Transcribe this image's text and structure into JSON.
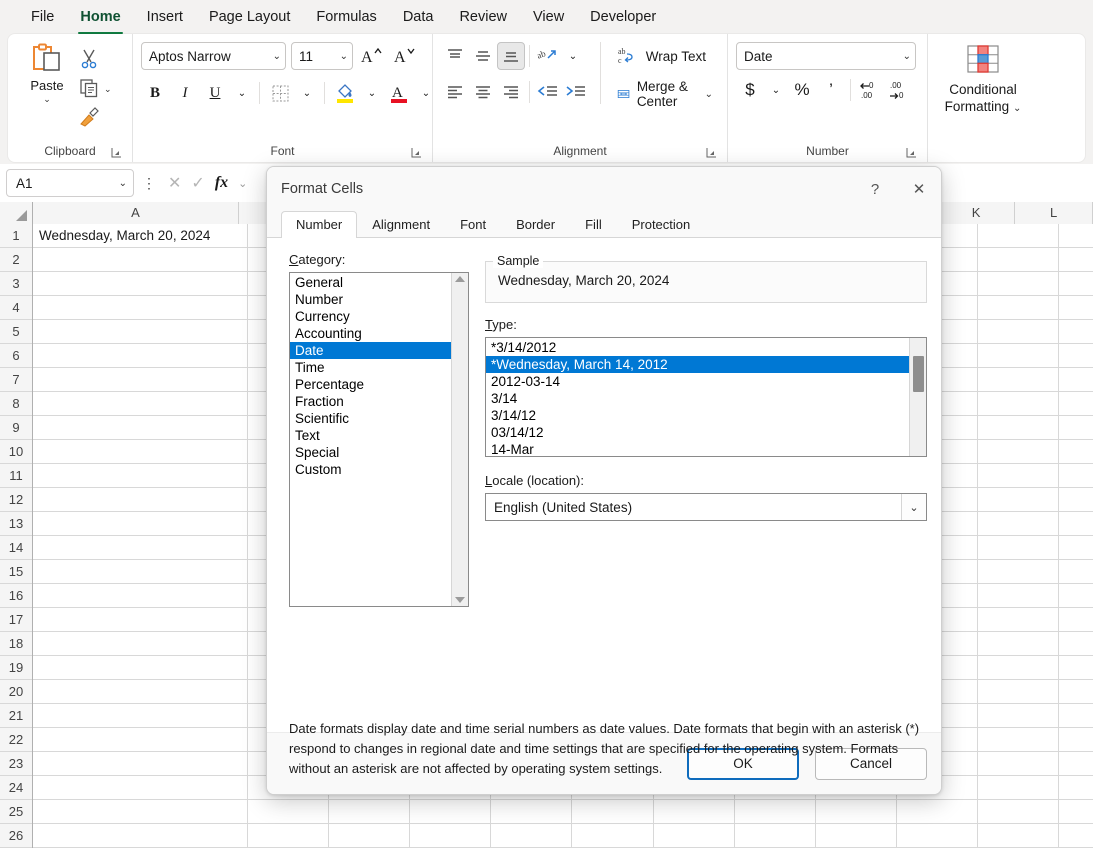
{
  "ribbon": {
    "tabs": [
      {
        "label": "File",
        "active": false
      },
      {
        "label": "Home",
        "active": true
      },
      {
        "label": "Insert",
        "active": false
      },
      {
        "label": "Page Layout",
        "active": false
      },
      {
        "label": "Formulas",
        "active": false
      },
      {
        "label": "Data",
        "active": false
      },
      {
        "label": "Review",
        "active": false
      },
      {
        "label": "View",
        "active": false
      },
      {
        "label": "Developer",
        "active": false
      }
    ],
    "clipboard": {
      "group_label": "Clipboard",
      "paste_label": "Paste",
      "icons": [
        "paste-icon",
        "cut-icon",
        "copy-icon",
        "format-painter-icon"
      ]
    },
    "font": {
      "group_label": "Font",
      "font_name": "Aptos Narrow",
      "font_size": "11",
      "grow_font": "A",
      "shrink_font": "A",
      "bold": "B",
      "italic": "I",
      "underline": "U"
    },
    "alignment": {
      "group_label": "Alignment",
      "wrap_text": "Wrap Text",
      "merge_center": "Merge & Center"
    },
    "number": {
      "group_label": "Number",
      "format": "Date",
      "currency": "$",
      "percent": "%",
      "comma": "’",
      "increase_decimal": "Increase Decimal",
      "decrease_decimal": "Decrease Decimal"
    },
    "conditional_formatting": {
      "line1": "Conditional",
      "line2": "Formatting"
    }
  },
  "formula_bar": {
    "name_box": "A1",
    "formula_value": "",
    "cancel_icon": "cancel-icon",
    "enter_icon": "enter-icon",
    "fx_label": "fx"
  },
  "grid": {
    "columns": [
      "A",
      "",
      "",
      "",
      "",
      "",
      "",
      "",
      "",
      "",
      "K",
      "L"
    ],
    "visible_column_labels": [
      "A",
      "K",
      "L"
    ],
    "rows": [
      "1",
      "2",
      "3",
      "4",
      "5",
      "6",
      "7",
      "8",
      "9",
      "10",
      "11",
      "12",
      "13",
      "14",
      "15",
      "16",
      "17",
      "18",
      "19",
      "20",
      "21",
      "22",
      "23",
      "24",
      "25",
      "26"
    ],
    "cell_a1": "Wednesday, March 20, 2024"
  },
  "dialog": {
    "title": "Format Cells",
    "help_icon": "?",
    "close_icon": "✕",
    "tabs": [
      {
        "label": "Number",
        "active": true
      },
      {
        "label": "Alignment",
        "active": false
      },
      {
        "label": "Font",
        "active": false
      },
      {
        "label": "Border",
        "active": false
      },
      {
        "label": "Fill",
        "active": false
      },
      {
        "label": "Protection",
        "active": false
      }
    ],
    "category_label": "Category:",
    "categories": [
      {
        "label": "General",
        "selected": false
      },
      {
        "label": "Number",
        "selected": false
      },
      {
        "label": "Currency",
        "selected": false
      },
      {
        "label": "Accounting",
        "selected": false
      },
      {
        "label": "Date",
        "selected": true
      },
      {
        "label": "Time",
        "selected": false
      },
      {
        "label": "Percentage",
        "selected": false
      },
      {
        "label": "Fraction",
        "selected": false
      },
      {
        "label": "Scientific",
        "selected": false
      },
      {
        "label": "Text",
        "selected": false
      },
      {
        "label": "Special",
        "selected": false
      },
      {
        "label": "Custom",
        "selected": false
      }
    ],
    "sample_legend": "Sample",
    "sample_value": "Wednesday, March 20, 2024",
    "type_label": "Type:",
    "types": [
      {
        "label": "*3/14/2012",
        "selected": false
      },
      {
        "label": "*Wednesday, March 14, 2012",
        "selected": true
      },
      {
        "label": "2012-03-14",
        "selected": false
      },
      {
        "label": "3/14",
        "selected": false
      },
      {
        "label": "3/14/12",
        "selected": false
      },
      {
        "label": "03/14/12",
        "selected": false
      },
      {
        "label": "14-Mar",
        "selected": false
      }
    ],
    "locale_label": "Locale (location):",
    "locale_value": "English (United States)",
    "description": "Date formats display date and time serial numbers as date values.  Date formats that begin with an asterisk (*) respond to changes in regional date and time settings that are specified for the operating system. Formats without an asterisk are not affected by operating system settings.",
    "ok_label": "OK",
    "cancel_label": "Cancel"
  },
  "colors": {
    "accent_green": "#107c41",
    "selection_blue": "#0078d4",
    "primary_border": "#0f6cbd",
    "ribbon_bg": "#f3f2f1"
  }
}
